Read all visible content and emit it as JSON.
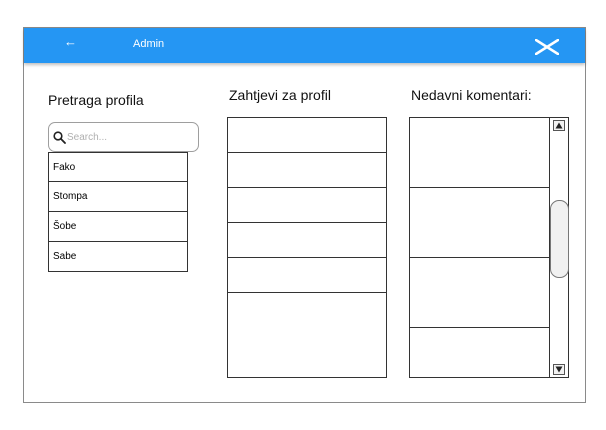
{
  "header": {
    "back_icon": "←",
    "title": "Admin",
    "close_icon": "close-x-icon",
    "color": "#2596f3"
  },
  "profile_search": {
    "heading": "Pretraga profila",
    "placeholder": "Search...",
    "value": "",
    "results": [
      "Fako",
      "Stompa",
      "Šobe",
      "Sabe"
    ]
  },
  "profile_requests": {
    "heading": "Zahtjevi za profil",
    "rows": [
      "",
      "",
      "",
      "",
      ""
    ]
  },
  "recent_comments": {
    "heading": "Nedavni komentari:",
    "rows": [
      "",
      "",
      "",
      ""
    ],
    "scroll_position": 0.45
  }
}
